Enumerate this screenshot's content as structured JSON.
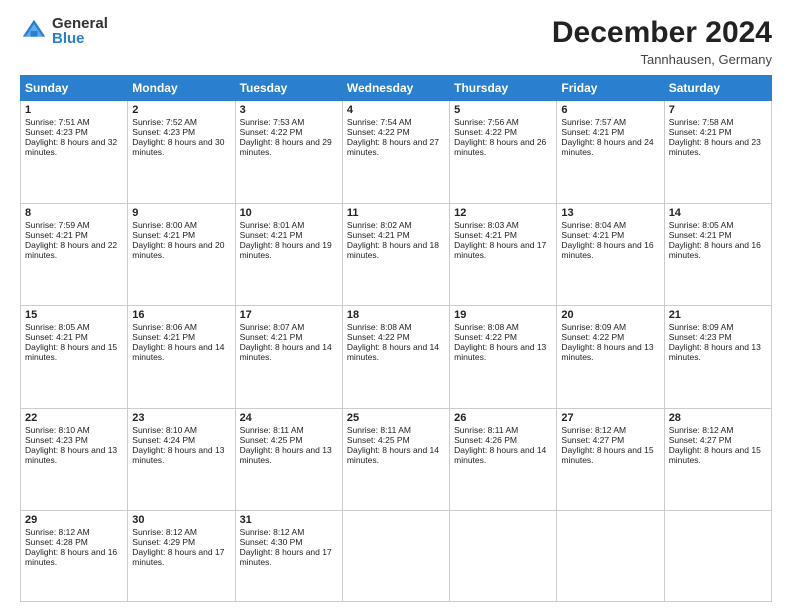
{
  "logo": {
    "general": "General",
    "blue": "Blue"
  },
  "title": "December 2024",
  "location": "Tannhausen, Germany",
  "headers": [
    "Sunday",
    "Monday",
    "Tuesday",
    "Wednesday",
    "Thursday",
    "Friday",
    "Saturday"
  ],
  "weeks": [
    [
      {
        "day": "1",
        "sunrise": "Sunrise: 7:51 AM",
        "sunset": "Sunset: 4:23 PM",
        "daylight": "Daylight: 8 hours and 32 minutes."
      },
      {
        "day": "2",
        "sunrise": "Sunrise: 7:52 AM",
        "sunset": "Sunset: 4:23 PM",
        "daylight": "Daylight: 8 hours and 30 minutes."
      },
      {
        "day": "3",
        "sunrise": "Sunrise: 7:53 AM",
        "sunset": "Sunset: 4:22 PM",
        "daylight": "Daylight: 8 hours and 29 minutes."
      },
      {
        "day": "4",
        "sunrise": "Sunrise: 7:54 AM",
        "sunset": "Sunset: 4:22 PM",
        "daylight": "Daylight: 8 hours and 27 minutes."
      },
      {
        "day": "5",
        "sunrise": "Sunrise: 7:56 AM",
        "sunset": "Sunset: 4:22 PM",
        "daylight": "Daylight: 8 hours and 26 minutes."
      },
      {
        "day": "6",
        "sunrise": "Sunrise: 7:57 AM",
        "sunset": "Sunset: 4:21 PM",
        "daylight": "Daylight: 8 hours and 24 minutes."
      },
      {
        "day": "7",
        "sunrise": "Sunrise: 7:58 AM",
        "sunset": "Sunset: 4:21 PM",
        "daylight": "Daylight: 8 hours and 23 minutes."
      }
    ],
    [
      {
        "day": "8",
        "sunrise": "Sunrise: 7:59 AM",
        "sunset": "Sunset: 4:21 PM",
        "daylight": "Daylight: 8 hours and 22 minutes."
      },
      {
        "day": "9",
        "sunrise": "Sunrise: 8:00 AM",
        "sunset": "Sunset: 4:21 PM",
        "daylight": "Daylight: 8 hours and 20 minutes."
      },
      {
        "day": "10",
        "sunrise": "Sunrise: 8:01 AM",
        "sunset": "Sunset: 4:21 PM",
        "daylight": "Daylight: 8 hours and 19 minutes."
      },
      {
        "day": "11",
        "sunrise": "Sunrise: 8:02 AM",
        "sunset": "Sunset: 4:21 PM",
        "daylight": "Daylight: 8 hours and 18 minutes."
      },
      {
        "day": "12",
        "sunrise": "Sunrise: 8:03 AM",
        "sunset": "Sunset: 4:21 PM",
        "daylight": "Daylight: 8 hours and 17 minutes."
      },
      {
        "day": "13",
        "sunrise": "Sunrise: 8:04 AM",
        "sunset": "Sunset: 4:21 PM",
        "daylight": "Daylight: 8 hours and 16 minutes."
      },
      {
        "day": "14",
        "sunrise": "Sunrise: 8:05 AM",
        "sunset": "Sunset: 4:21 PM",
        "daylight": "Daylight: 8 hours and 16 minutes."
      }
    ],
    [
      {
        "day": "15",
        "sunrise": "Sunrise: 8:05 AM",
        "sunset": "Sunset: 4:21 PM",
        "daylight": "Daylight: 8 hours and 15 minutes."
      },
      {
        "day": "16",
        "sunrise": "Sunrise: 8:06 AM",
        "sunset": "Sunset: 4:21 PM",
        "daylight": "Daylight: 8 hours and 14 minutes."
      },
      {
        "day": "17",
        "sunrise": "Sunrise: 8:07 AM",
        "sunset": "Sunset: 4:21 PM",
        "daylight": "Daylight: 8 hours and 14 minutes."
      },
      {
        "day": "18",
        "sunrise": "Sunrise: 8:08 AM",
        "sunset": "Sunset: 4:22 PM",
        "daylight": "Daylight: 8 hours and 14 minutes."
      },
      {
        "day": "19",
        "sunrise": "Sunrise: 8:08 AM",
        "sunset": "Sunset: 4:22 PM",
        "daylight": "Daylight: 8 hours and 13 minutes."
      },
      {
        "day": "20",
        "sunrise": "Sunrise: 8:09 AM",
        "sunset": "Sunset: 4:22 PM",
        "daylight": "Daylight: 8 hours and 13 minutes."
      },
      {
        "day": "21",
        "sunrise": "Sunrise: 8:09 AM",
        "sunset": "Sunset: 4:23 PM",
        "daylight": "Daylight: 8 hours and 13 minutes."
      }
    ],
    [
      {
        "day": "22",
        "sunrise": "Sunrise: 8:10 AM",
        "sunset": "Sunset: 4:23 PM",
        "daylight": "Daylight: 8 hours and 13 minutes."
      },
      {
        "day": "23",
        "sunrise": "Sunrise: 8:10 AM",
        "sunset": "Sunset: 4:24 PM",
        "daylight": "Daylight: 8 hours and 13 minutes."
      },
      {
        "day": "24",
        "sunrise": "Sunrise: 8:11 AM",
        "sunset": "Sunset: 4:25 PM",
        "daylight": "Daylight: 8 hours and 13 minutes."
      },
      {
        "day": "25",
        "sunrise": "Sunrise: 8:11 AM",
        "sunset": "Sunset: 4:25 PM",
        "daylight": "Daylight: 8 hours and 14 minutes."
      },
      {
        "day": "26",
        "sunrise": "Sunrise: 8:11 AM",
        "sunset": "Sunset: 4:26 PM",
        "daylight": "Daylight: 8 hours and 14 minutes."
      },
      {
        "day": "27",
        "sunrise": "Sunrise: 8:12 AM",
        "sunset": "Sunset: 4:27 PM",
        "daylight": "Daylight: 8 hours and 15 minutes."
      },
      {
        "day": "28",
        "sunrise": "Sunrise: 8:12 AM",
        "sunset": "Sunset: 4:27 PM",
        "daylight": "Daylight: 8 hours and 15 minutes."
      }
    ],
    [
      {
        "day": "29",
        "sunrise": "Sunrise: 8:12 AM",
        "sunset": "Sunset: 4:28 PM",
        "daylight": "Daylight: 8 hours and 16 minutes."
      },
      {
        "day": "30",
        "sunrise": "Sunrise: 8:12 AM",
        "sunset": "Sunset: 4:29 PM",
        "daylight": "Daylight: 8 hours and 17 minutes."
      },
      {
        "day": "31",
        "sunrise": "Sunrise: 8:12 AM",
        "sunset": "Sunset: 4:30 PM",
        "daylight": "Daylight: 8 hours and 17 minutes."
      },
      null,
      null,
      null,
      null
    ]
  ]
}
